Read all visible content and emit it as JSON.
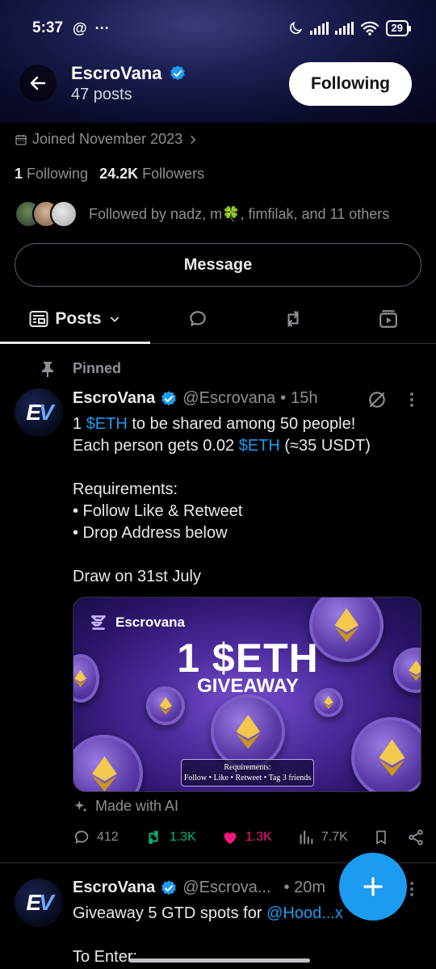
{
  "status_bar": {
    "time": "5:37",
    "battery": "29"
  },
  "header": {
    "name": "EscroVana",
    "posts": "47 posts",
    "follow_button": "Following"
  },
  "profile": {
    "joined": "Joined November 2023",
    "following_count": "1",
    "following_label": "Following",
    "followers_count": "24.2K",
    "followers_label": "Followers",
    "followed_by": "Followed by nadz, m🍀, fimfilak, and 11 others",
    "message_button": "Message"
  },
  "tabs": {
    "posts": "Posts"
  },
  "pinned_tweet": {
    "pinned_label": "Pinned",
    "name": "EscroVana",
    "handle": "@Escrovana",
    "time": "15h",
    "line1_pre": "1 ",
    "line1_link": "$ETH",
    "line1_post": " to be shared among 50 people!",
    "line2_pre": "Each person gets 0.02 ",
    "line2_link": "$ETH",
    "line2_post": " (≈35 USDT)",
    "body_rest": "Requirements:\n• Follow Like & Retweet\n• Drop Address below\n\nDraw on 31st July",
    "media": {
      "brand": "Escrovana",
      "title": "1 $ETH",
      "subtitle": "GIVEAWAY",
      "req_title": "Requirements:",
      "req_text": "Follow • Like • Retweet • Tag 3 friends",
      "coin_label": "ETH"
    },
    "ai_note": "Made with AI",
    "replies": "412",
    "retweets": "1.3K",
    "likes": "1.3K",
    "views": "7.7K"
  },
  "second_tweet": {
    "name": "EscroVana",
    "handle": "@Escrova...",
    "time": "• 20m",
    "body_pre": "Giveaway 5 GTD spots for ",
    "body_link": "@Hood...x",
    "body_next": "To Enter:"
  },
  "colors": {
    "accent": "#1d9bf0",
    "retweet": "#00ba7c",
    "like": "#f91880",
    "muted": "#8b9096"
  }
}
